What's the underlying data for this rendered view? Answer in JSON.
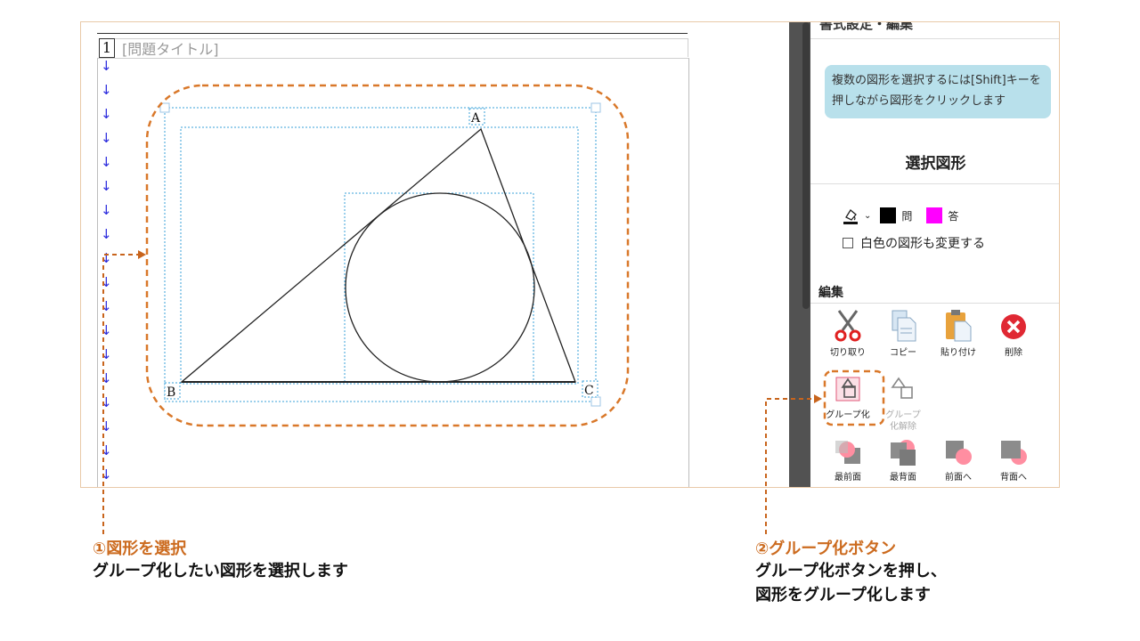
{
  "document": {
    "question_number": "1",
    "question_title_placeholder": "[問題タイトル]",
    "arrow_char": "↓",
    "vertices": {
      "a": "A",
      "b": "B",
      "c": "C"
    }
  },
  "panel": {
    "header_title": "書式設定・編集",
    "collapse_icon": "chevron-up-icon",
    "hint": "複数の図形を選択するには[Shift]キーを押しながら図形をクリックします",
    "selected_shapes_title": "選択図形",
    "fill": {
      "question_label": "問",
      "answer_label": "答",
      "question_color": "#000000",
      "answer_color": "#ff00ff"
    },
    "white_shapes_checkbox": "白色の図形も変更する",
    "edit_section_title": "編集",
    "tools": {
      "cut": "切り取り",
      "copy": "コピー",
      "paste": "貼り付け",
      "delete": "削除",
      "group": "グループ化",
      "ungroup": "グループ化解除",
      "bring_front": "最前面",
      "send_back": "最背面",
      "forward": "前面へ",
      "backward": "背面へ"
    }
  },
  "callouts": {
    "step1_title": "①図形を選択",
    "step1_text": "グループ化したい図形を選択します",
    "step2_title": "②グループ化ボタン",
    "step2_line1": "グループ化ボタンを押し、",
    "step2_line2": "図形をグループ化します"
  },
  "colors": {
    "callout_accent": "#cc6b1f",
    "selection_blue": "#3aa0d8",
    "arrow_blue": "#2b2bdd",
    "hint_bg": "#b8e0eb"
  }
}
